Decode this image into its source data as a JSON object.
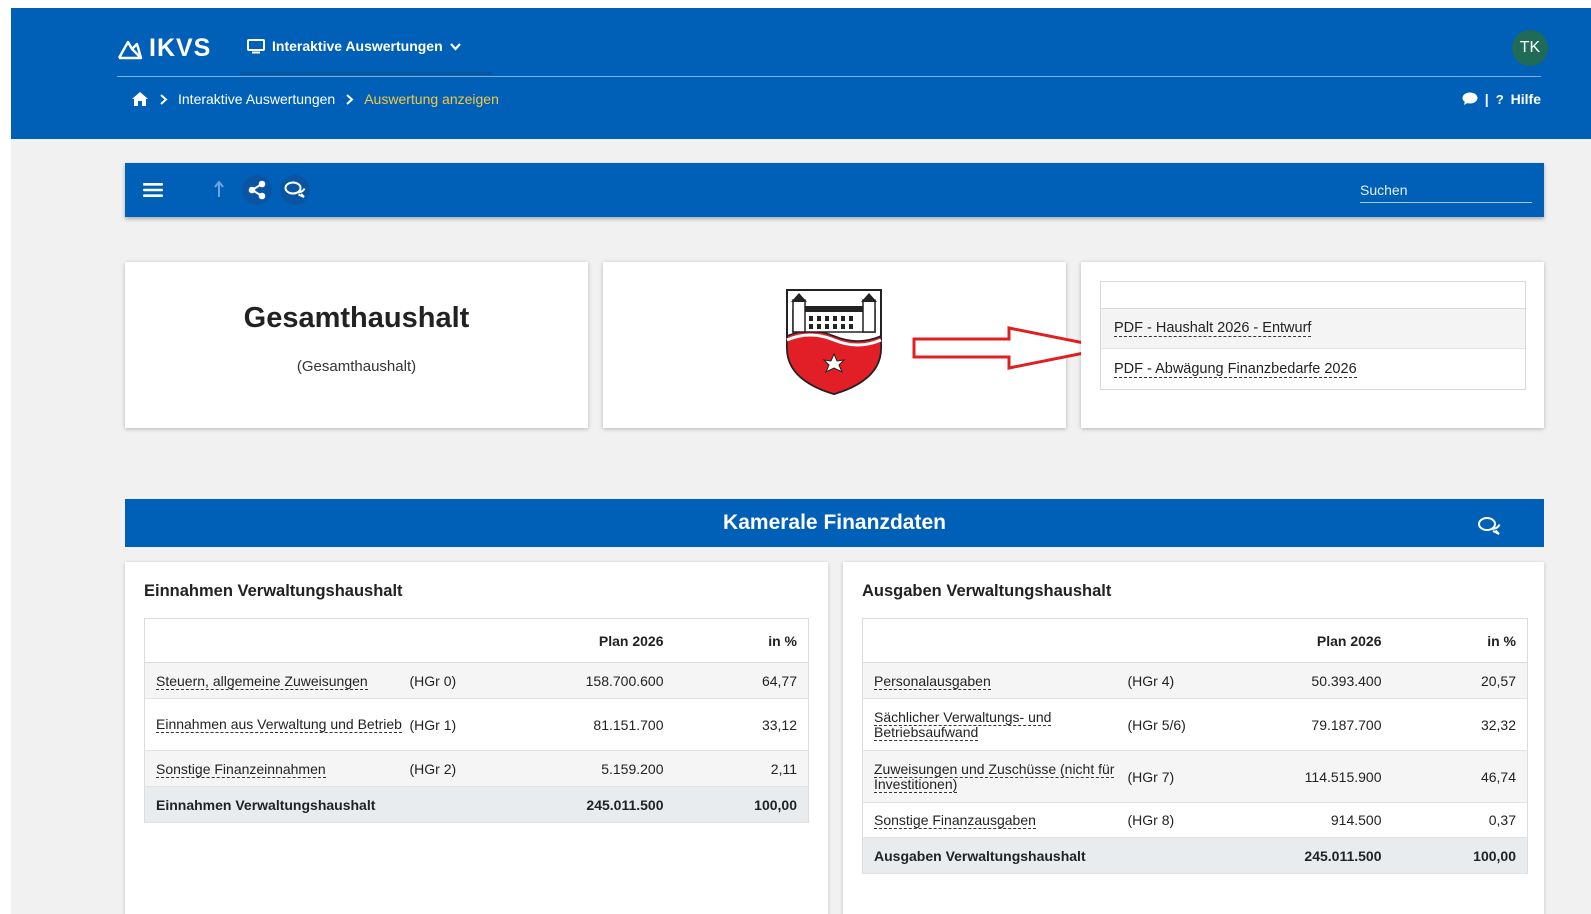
{
  "header": {
    "brand": "IKVS",
    "menu_label": "Interaktive Auswertungen",
    "avatar_initials": "TK",
    "help_label": "Hilfe"
  },
  "breadcrumb": {
    "items": [
      "Interaktive Auswertungen",
      "Auswertung anzeigen"
    ]
  },
  "toolbar": {
    "search_placeholder": "Suchen"
  },
  "title_card": {
    "title": "Gesamthaushalt",
    "subtitle": "(Gesamthaushalt)"
  },
  "links_card": {
    "links": [
      "PDF - Haushalt 2026 - Entwurf",
      "PDF - Abwägung Finanzbedarfe 2026"
    ]
  },
  "section": {
    "title": "Kamerale Finanzdaten"
  },
  "income": {
    "title": "Einnahmen Verwaltungshaushalt",
    "headers": [
      "",
      "",
      "Plan 2026",
      "in %"
    ],
    "rows": [
      {
        "label": "Steuern, allgemeine Zuweisungen",
        "group": "(HGr 0)",
        "plan": "158.700.600",
        "pct": "64,77"
      },
      {
        "label": "Einnahmen aus Verwaltung und Betrieb",
        "group": "(HGr 1)",
        "plan": "81.151.700",
        "pct": "33,12"
      },
      {
        "label": "Sonstige Finanzeinnahmen",
        "group": "(HGr 2)",
        "plan": "5.159.200",
        "pct": "2,11"
      }
    ],
    "total": {
      "label": "Einnahmen Verwaltungshaushalt",
      "plan": "245.011.500",
      "pct": "100,00"
    }
  },
  "expenses": {
    "title": "Ausgaben Verwaltungshaushalt",
    "headers": [
      "",
      "",
      "Plan 2026",
      "in %"
    ],
    "rows": [
      {
        "label": "Personalausgaben",
        "group": "(HGr 4)",
        "plan": "50.393.400",
        "pct": "20,57"
      },
      {
        "label": "Sächlicher Verwaltungs- und Betriebsaufwand",
        "group": "(HGr 5/6)",
        "plan": "79.187.700",
        "pct": "32,32"
      },
      {
        "label": "Zuweisungen und Zuschüsse (nicht für Investitionen)",
        "group": "(HGr 7)",
        "plan": "114.515.900",
        "pct": "46,74"
      },
      {
        "label": "Sonstige Finanzausgaben",
        "group": "(HGr 8)",
        "plan": "914.500",
        "pct": "0,37"
      }
    ],
    "total": {
      "label": "Ausgaben Verwaltungshaushalt",
      "plan": "245.011.500",
      "pct": "100,00"
    }
  },
  "colors": {
    "primary": "#0060b8",
    "accent_breadcrumb": "#f5c842",
    "avatar": "#1f6b57",
    "arrow": "#e02020"
  },
  "icons": [
    "ikvs-logo-icon",
    "monitor-icon",
    "chevron-down-icon",
    "home-icon",
    "chevron-right-icon",
    "chat-bubble-icon",
    "question-icon",
    "hamburger-menu-icon",
    "upload-icon",
    "share-icon",
    "comments-icon",
    "coat-of-arms-icon",
    "red-arrow-icon"
  ]
}
